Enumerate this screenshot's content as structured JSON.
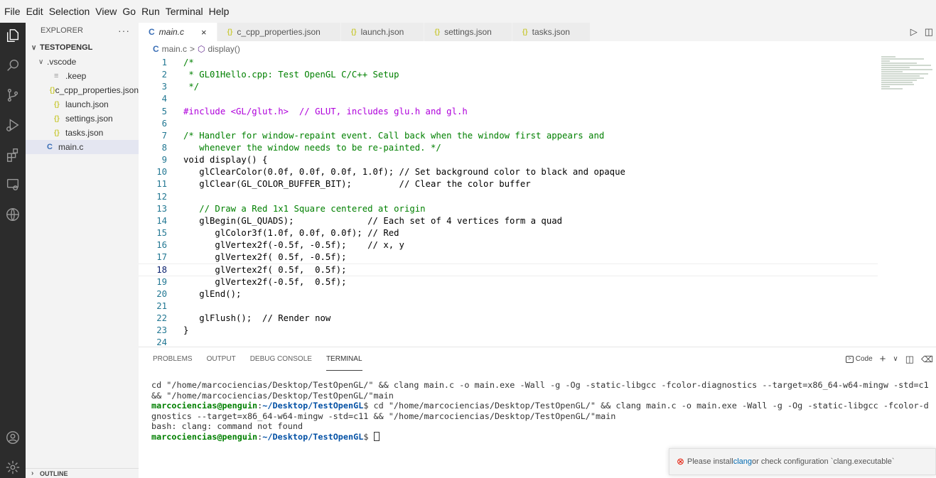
{
  "menu": [
    "File",
    "Edit",
    "Selection",
    "View",
    "Go",
    "Run",
    "Terminal",
    "Help"
  ],
  "explorer": {
    "title": "EXPLORER",
    "more": "···",
    "root": "TESTOPENGL",
    "items": [
      {
        "label": ".vscode",
        "indent": 1,
        "chev": "∨",
        "icon": "",
        "kind": "folder"
      },
      {
        "label": ".keep",
        "indent": 2,
        "chev": "",
        "icon": "≡",
        "kind": "keep"
      },
      {
        "label": "c_cpp_properties.json",
        "indent": 2,
        "chev": "",
        "icon": "{}",
        "kind": "json"
      },
      {
        "label": "launch.json",
        "indent": 2,
        "chev": "",
        "icon": "{}",
        "kind": "json"
      },
      {
        "label": "settings.json",
        "indent": 2,
        "chev": "",
        "icon": "{}",
        "kind": "json"
      },
      {
        "label": "tasks.json",
        "indent": 2,
        "chev": "",
        "icon": "{}",
        "kind": "json"
      },
      {
        "label": "main.c",
        "indent": 1,
        "chev": "",
        "icon": "C",
        "kind": "c",
        "selected": true
      }
    ],
    "outline": "OUTLINE"
  },
  "tabs": [
    {
      "label": "main.c",
      "icon": "C",
      "kind": "c",
      "active": true,
      "close": "×"
    },
    {
      "label": "c_cpp_properties.json",
      "icon": "{}",
      "kind": "json"
    },
    {
      "label": "launch.json",
      "icon": "{}",
      "kind": "json"
    },
    {
      "label": "settings.json",
      "icon": "{}",
      "kind": "json"
    },
    {
      "label": "tasks.json",
      "icon": "{}",
      "kind": "json"
    }
  ],
  "breadcrumb": {
    "file_icon": "C",
    "file": "main.c",
    "sep": ">",
    "symbol": "display()"
  },
  "editor": {
    "current_line": 18,
    "lines": [
      {
        "n": "1",
        "t": "/*",
        "k": "com"
      },
      {
        "n": "2",
        "t": " * GL01Hello.cpp: Test OpenGL C/C++ Setup",
        "k": "com"
      },
      {
        "n": "3",
        "t": " */",
        "k": "com"
      },
      {
        "n": "4",
        "t": "",
        "k": ""
      },
      {
        "n": "5",
        "t": "#include <GL/glut.h>  // GLUT, includes glu.h and gl.h",
        "k": "pp"
      },
      {
        "n": "6",
        "t": "",
        "k": ""
      },
      {
        "n": "7",
        "t": "/* Handler for window-repaint event. Call back when the window first appears and",
        "k": "com"
      },
      {
        "n": "8",
        "t": "   whenever the window needs to be re-painted. */",
        "k": "com"
      },
      {
        "n": "9",
        "t": "void display() {",
        "k": ""
      },
      {
        "n": "10",
        "t": "   glClearColor(0.0f, 0.0f, 0.0f, 1.0f); // Set background color to black and opaque",
        "k": ""
      },
      {
        "n": "11",
        "t": "   glClear(GL_COLOR_BUFFER_BIT);         // Clear the color buffer",
        "k": ""
      },
      {
        "n": "12",
        "t": "",
        "k": ""
      },
      {
        "n": "13",
        "t": "   // Draw a Red 1x1 Square centered at origin",
        "k": "com"
      },
      {
        "n": "14",
        "t": "   glBegin(GL_QUADS);              // Each set of 4 vertices form a quad",
        "k": ""
      },
      {
        "n": "15",
        "t": "      glColor3f(1.0f, 0.0f, 0.0f); // Red",
        "k": ""
      },
      {
        "n": "16",
        "t": "      glVertex2f(-0.5f, -0.5f);    // x, y",
        "k": ""
      },
      {
        "n": "17",
        "t": "      glVertex2f( 0.5f, -0.5f);",
        "k": ""
      },
      {
        "n": "18",
        "t": "      glVertex2f( 0.5f,  0.5f);",
        "k": ""
      },
      {
        "n": "19",
        "t": "      glVertex2f(-0.5f,  0.5f);",
        "k": ""
      },
      {
        "n": "20",
        "t": "   glEnd();",
        "k": ""
      },
      {
        "n": "21",
        "t": "",
        "k": ""
      },
      {
        "n": "22",
        "t": "   glFlush();  // Render now",
        "k": ""
      },
      {
        "n": "23",
        "t": "}",
        "k": ""
      },
      {
        "n": "24",
        "t": "",
        "k": ""
      }
    ]
  },
  "panel": {
    "tabs": [
      "PROBLEMS",
      "OUTPUT",
      "DEBUG CONSOLE",
      "TERMINAL"
    ],
    "active_tab": "TERMINAL",
    "terminal_name": "Code",
    "add": "+",
    "dropdown": "∨",
    "split": "◫",
    "trash": "🗑"
  },
  "terminal": {
    "lines": [
      {
        "parts": [
          {
            "t": "cd \"/home/marcociencias/Desktop/TestOpenGL/\" && clang main.c -o main.exe -Wall -g -Og -static-libgcc -fcolor-diagnostics --target=x86_64-w64-mingw -std=c1",
            "c": ""
          }
        ]
      },
      {
        "parts": [
          {
            "t": "&& \"/home/marcociencias/Desktop/TestOpenGL/\"main",
            "c": ""
          }
        ]
      },
      {
        "parts": [
          {
            "t": "marcociencias@penguin",
            "c": "user"
          },
          {
            "t": ":",
            "c": ""
          },
          {
            "t": "~/Desktop/TestOpenGL",
            "c": "path"
          },
          {
            "t": "$ cd \"/home/marcociencias/Desktop/TestOpenGL/\" && clang main.c -o main.exe -Wall -g -Og -static-libgcc -fcolor-d",
            "c": ""
          }
        ]
      },
      {
        "parts": [
          {
            "t": "gnostics --target=x86_64-w64-mingw -std=c11 && \"/home/marcociencias/Desktop/TestOpenGL/\"main",
            "c": ""
          }
        ]
      },
      {
        "parts": [
          {
            "t": "bash: clang: command not found",
            "c": ""
          }
        ]
      },
      {
        "parts": [
          {
            "t": "marcociencias@penguin",
            "c": "user"
          },
          {
            "t": ":",
            "c": ""
          },
          {
            "t": "~/Desktop/TestOpenGL",
            "c": "path"
          },
          {
            "t": "$ ",
            "c": ""
          }
        ],
        "cursor": true
      }
    ]
  },
  "notification": {
    "prefix": "Please install ",
    "link": "clang",
    "suffix": " or check configuration `clang.executable`"
  }
}
